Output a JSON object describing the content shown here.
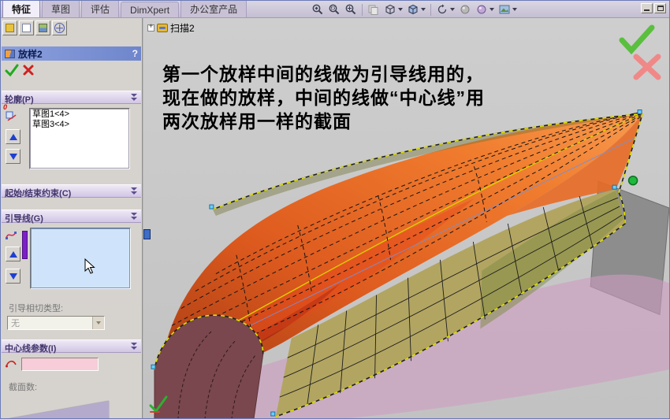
{
  "colors": {
    "accent_blue": "#6f86cc",
    "panel_bg": "#d6d3ce",
    "section_header": "#d2c6e4",
    "selection_box_blue": "#cfe4fa",
    "guide_bar_purple": "#7d1fc8",
    "centerline_field_pink": "#f6cdd9",
    "graphics_bg": "#c8c8c8",
    "surface_orange": "#e06020",
    "surface_maroon": "#7a474e",
    "surface_tan": "#b2a562",
    "surface_pink": "#cf9cc2",
    "slab_gray": "#8d8d8d",
    "preview_edge_yellow": "#e4e400",
    "confirm_green": "#5abf3f",
    "cancel_red": "#f08888",
    "endpoint_green": "#1fb83c"
  },
  "tab_bar": {
    "tabs": [
      {
        "label": "特征",
        "active": true
      },
      {
        "label": "草图",
        "active": false
      },
      {
        "label": "评估",
        "active": false
      },
      {
        "label": "DimXpert",
        "active": false
      },
      {
        "label": "办公室产品",
        "active": false
      }
    ]
  },
  "toolbar": {
    "icons": [
      {
        "name": "zoom-in-out"
      },
      {
        "name": "zoom-area"
      },
      {
        "name": "zoom-fit"
      },
      {
        "name": "previous-view",
        "disabled": true
      },
      {
        "name": "view-orientation",
        "dropdown": true
      },
      {
        "name": "display-style",
        "dropdown": true
      },
      {
        "name": "rotate-view",
        "dropdown": true
      },
      {
        "name": "hide-show-items"
      },
      {
        "name": "appearances",
        "dropdown": true
      },
      {
        "name": "apply-scene",
        "dropdown": true
      }
    ]
  },
  "property_manager": {
    "title": "放样2",
    "help_label": "?",
    "profiles": {
      "label": "轮廓(P)",
      "badge": "0",
      "items": [
        "草图1<4>",
        "草图3<4>"
      ]
    },
    "start_end_constraints": {
      "label": "起始/结束约束(C)"
    },
    "guide_curves": {
      "label": "引导线(G)",
      "items": []
    },
    "guide_tangency": {
      "label": "引导相切类型:",
      "value": "无"
    },
    "centerline_params": {
      "label": "中心线参数(I)",
      "value": ""
    },
    "sections": {
      "label": "截面数:"
    }
  },
  "graphics": {
    "feature_tree_item": "扫描2",
    "annotation": {
      "line1": "第一个放样中间的线做为引导线用的，",
      "line2": "现在做的放样，中间的线做“中心线”用",
      "line3": "两次放样用一样的截面"
    }
  }
}
